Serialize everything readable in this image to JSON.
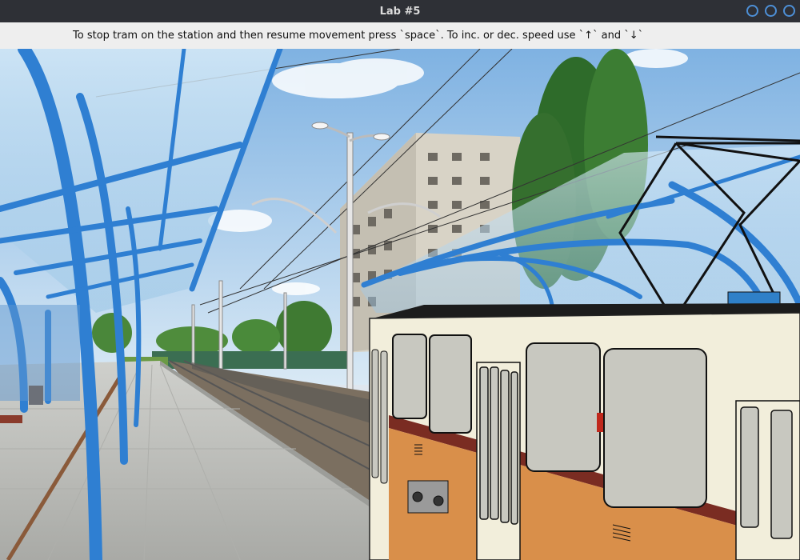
{
  "window": {
    "title": "Lab #5",
    "buttons": [
      "minimize",
      "maximize",
      "close"
    ]
  },
  "instructions": {
    "text": "To stop tram on the station and then resume movement press `space`. To inc. or dec. speed use `↑` and `↓`"
  },
  "scene": {
    "background": "tram station platform with blue canopy, apartment building, trees and overhead wires",
    "tram": {
      "body_color": "#f2eedb",
      "stripe_color": "#7a2c22",
      "lower_color": "#d98f4a",
      "window_color": "#c8c8c0"
    },
    "colors": {
      "sky": "#9fc7ea",
      "canopy_blue": "#2f7fd2",
      "platform": "#bfc0bd"
    }
  }
}
